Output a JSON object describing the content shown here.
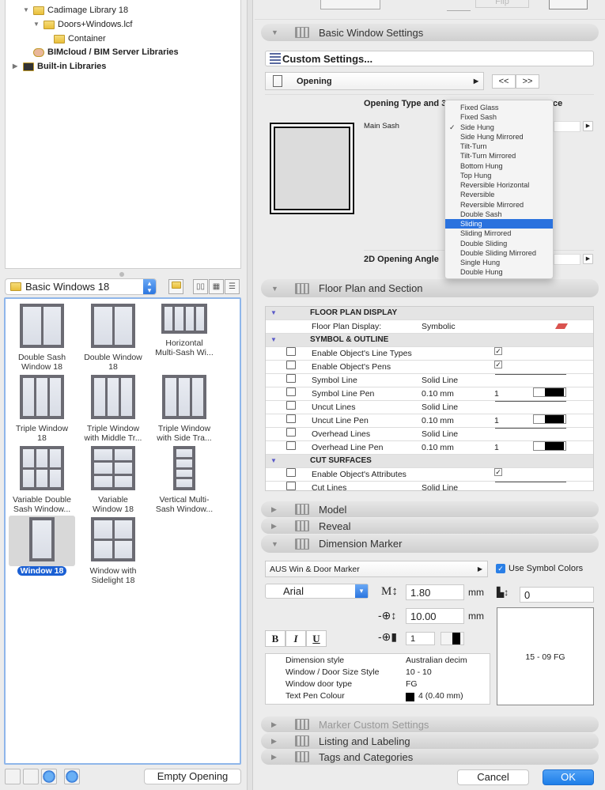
{
  "tree": [
    {
      "label": "Cadimage Library 18",
      "indent": 1,
      "expanded": true,
      "icon": "folder-icon"
    },
    {
      "label": "Doors+Windows.lcf",
      "indent": 2,
      "expanded": true,
      "icon": "folder-icon"
    },
    {
      "label": "Container",
      "indent": 3,
      "icon": "folder-icon"
    },
    {
      "label": "BIMcloud / BIM Server Libraries",
      "indent": 1,
      "bold": true,
      "icon": "bimcloud-icon"
    },
    {
      "label": "Built-in Libraries",
      "indent": 0,
      "bold": true,
      "collapsed": true,
      "icon": "library-icon"
    }
  ],
  "folder_select": {
    "value": "Basic Windows 18"
  },
  "library_items": [
    {
      "label1": "Double Sash",
      "label2": "Window 18",
      "cols": 2,
      "rows": 1
    },
    {
      "label1": "Double Window",
      "label2": "18",
      "cols": 2,
      "rows": 1
    },
    {
      "label1": "Horizontal",
      "label2": "Multi-Sash Wi...",
      "cols": 4,
      "rows": 1
    },
    {
      "label1": "Triple Window",
      "label2": "18",
      "cols": 3,
      "rows": 1
    },
    {
      "label1": "Triple Window",
      "label2": "with Middle Tr...",
      "cols": 3,
      "rows": 1
    },
    {
      "label1": "Triple Window",
      "label2": "with Side Tra...",
      "cols": 3,
      "rows": 1
    },
    {
      "label1": "Variable Double",
      "label2": "Sash Window...",
      "cols": 3,
      "rows": 2
    },
    {
      "label1": "Variable",
      "label2": "Window 18",
      "cols": 2,
      "rows": 3
    },
    {
      "label1": "Vertical Multi-",
      "label2": "Sash Window...",
      "cols": 1,
      "rows": 4
    },
    {
      "label1": "Window 18",
      "label2": "",
      "cols": 1,
      "rows": 1,
      "selected": true
    },
    {
      "label1": "Window with",
      "label2": "Sidelight 18",
      "cols": 2,
      "rows": 2
    }
  ],
  "empty_opening_label": "Empty Opening",
  "sections": {
    "basic": "Basic Window Settings",
    "floor": "Floor Plan and Section",
    "model": "Model",
    "reveal": "Reveal",
    "dimension": "Dimension Marker",
    "marker_custom": "Marker Custom Settings",
    "listing": "Listing and Labeling",
    "tags": "Tags and Categories"
  },
  "toolbar": {
    "flip_label": "Flip"
  },
  "custom_settings": "Custom Settings...",
  "opening_page": "Opening",
  "prev_label": "<<",
  "next_label": ">>",
  "opening_type_heading": "Opening Type and 3",
  "opening_type_heading_tail": "ce",
  "main_sash_label": "Main Sash",
  "angle_label": "2D Opening Angle",
  "opening_type_menu": {
    "checked": "Side Hung",
    "highlighted": "Sliding",
    "options": [
      "Fixed Glass",
      "Fixed Sash",
      "Side Hung",
      "Side Hung Mirrored",
      "Tilt-Turn",
      "Tilt-Turn Mirrored",
      "Bottom Hung",
      "Top Hung",
      "Reversible Horizontal",
      "Reversible",
      "Reversible Mirrored",
      "Double Sash",
      "Sliding",
      "Sliding Mirrored",
      "Double Sliding",
      "Double Sliding Mirrored",
      "Single Hung",
      "Double Hung"
    ]
  },
  "floor_table": [
    {
      "type": "group",
      "label": "FLOOR PLAN DISPLAY"
    },
    {
      "label": "Floor Plan Display:",
      "value": "Symbolic",
      "extra": "icon"
    },
    {
      "type": "group",
      "label": "SYMBOL & OUTLINE"
    },
    {
      "label": "Enable Object's Line Types",
      "check": true
    },
    {
      "label": "Enable Object's Pens",
      "check": true
    },
    {
      "label": "Symbol Line",
      "value": "Solid Line",
      "extra": "line"
    },
    {
      "label": "Symbol Line Pen",
      "value": "0.10 mm",
      "pen": "1"
    },
    {
      "label": "Uncut Lines",
      "value": "Solid Line",
      "extra": "line"
    },
    {
      "label": "Uncut Line Pen",
      "value": "0.10 mm",
      "pen": "1"
    },
    {
      "label": "Overhead Lines",
      "value": "Solid Line",
      "extra": "line"
    },
    {
      "label": "Overhead Line Pen",
      "value": "0.10 mm",
      "pen": "1"
    },
    {
      "type": "group",
      "label": "CUT SURFACES"
    },
    {
      "label": "Enable Object's Attributes",
      "check": true
    },
    {
      "label": "Cut Lines",
      "value": "Solid Line",
      "extra": "line"
    }
  ],
  "marker": {
    "type": "AUS Win & Door Marker",
    "use_symbol_colors": "Use Symbol Colors",
    "use_symbol_colors_checked": true,
    "font": "Arial",
    "text_size": "1.80",
    "marker_size": "10.00",
    "unit": "mm",
    "pen": "1",
    "offset": "0",
    "bold": "B",
    "italic": "I",
    "underline": "U",
    "params": [
      {
        "label": "Dimension style",
        "value": "Australian decim"
      },
      {
        "label": "Window / Door Size Style",
        "value": "10 - 10"
      },
      {
        "label": "Window door type",
        "value": "FG"
      },
      {
        "label": "Text Pen Colour",
        "value": "4 (0.40 mm)"
      }
    ],
    "preview": "15 - 09 FG"
  },
  "cancel_label": "Cancel",
  "ok_label": "OK",
  "colors": {
    "accent": "#2a72de",
    "ok": "#1e7ee8"
  }
}
